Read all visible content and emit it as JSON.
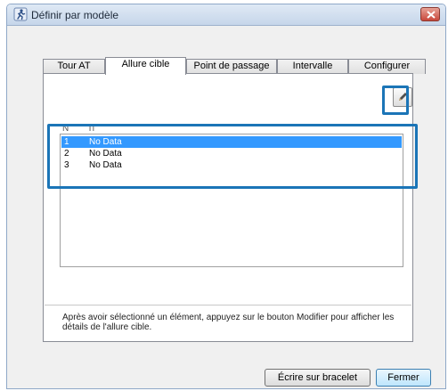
{
  "window": {
    "title": "Définir par modèle"
  },
  "tabs": [
    {
      "label": "Tour AT"
    },
    {
      "label": "Allure cible"
    },
    {
      "label": "Point de passage"
    },
    {
      "label": "Intervalle"
    },
    {
      "label": "Configurer"
    }
  ],
  "list": {
    "headers": [
      "N",
      "Ti"
    ],
    "rows": [
      {
        "num": "1",
        "value": "No Data"
      },
      {
        "num": "2",
        "value": "No Data"
      },
      {
        "num": "3",
        "value": "No Data"
      }
    ]
  },
  "help_text": "Après avoir sélectionné un élément, appuyez sur le bouton Modifier pour afficher les détails de l'allure cible.",
  "buttons": {
    "write": "Écrire sur bracelet",
    "close": "Fermer"
  },
  "colors": {
    "highlight": "#1b75b7",
    "selection": "#3399ff"
  },
  "icons": {
    "edit": "pencil-icon",
    "app": "runner-icon",
    "close": "close-icon"
  }
}
